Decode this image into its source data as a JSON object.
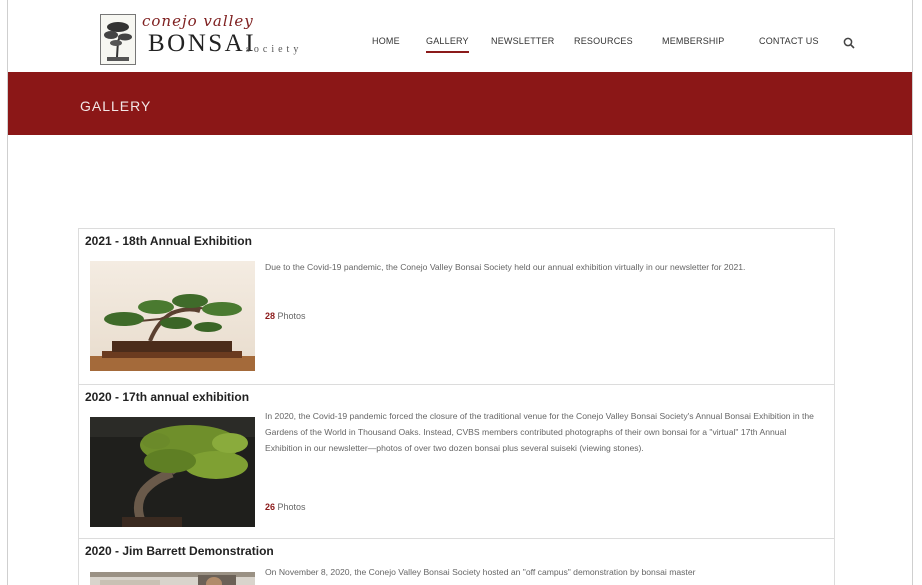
{
  "logo": {
    "top_line": "conejo valley",
    "main": "BONSAI",
    "suffix": "society"
  },
  "nav": {
    "items": [
      {
        "label": "HOME"
      },
      {
        "label": "GALLERY",
        "active": true
      },
      {
        "label": "NEWSLETTER"
      },
      {
        "label": "RESOURCES"
      },
      {
        "label": "MEMBERSHIP"
      },
      {
        "label": "CONTACT US"
      }
    ],
    "search_icon": "search-icon"
  },
  "banner": {
    "title": "GALLERY"
  },
  "gallery": {
    "items": [
      {
        "title": "2021 - 18th Annual Exhibition",
        "description": "Due to the Covid-19 pandemic, the Conejo Valley Bonsai Society held our annual exhibition virtually in our newsletter for 2021.",
        "count": "28",
        "count_label": " Photos"
      },
      {
        "title": "2020 - 17th annual exhibition",
        "description": "In 2020, the Covid-19 pandemic forced the closure of the traditional venue for the Conejo Valley Bonsai Society's Annual Bonsai Exhibition in the Gardens of the World in Thousand Oaks. Instead, CVBS members contributed photographs of their own bonsai for a \"virtual\" 17th Annual Exhibition in our newsletter—photos of over two dozen bonsai plus several suiseki (viewing stones).",
        "count": "26",
        "count_label": " Photos"
      },
      {
        "title": "2020 - Jim Barrett Demonstration",
        "description": "On November 8, 2020, the Conejo Valley Bonsai Society hosted an \"off campus\" demonstration by bonsai master",
        "count": "",
        "count_label": ""
      }
    ]
  },
  "colors": {
    "brand": "#8b1717",
    "accent_text": "#8b1a1a"
  }
}
